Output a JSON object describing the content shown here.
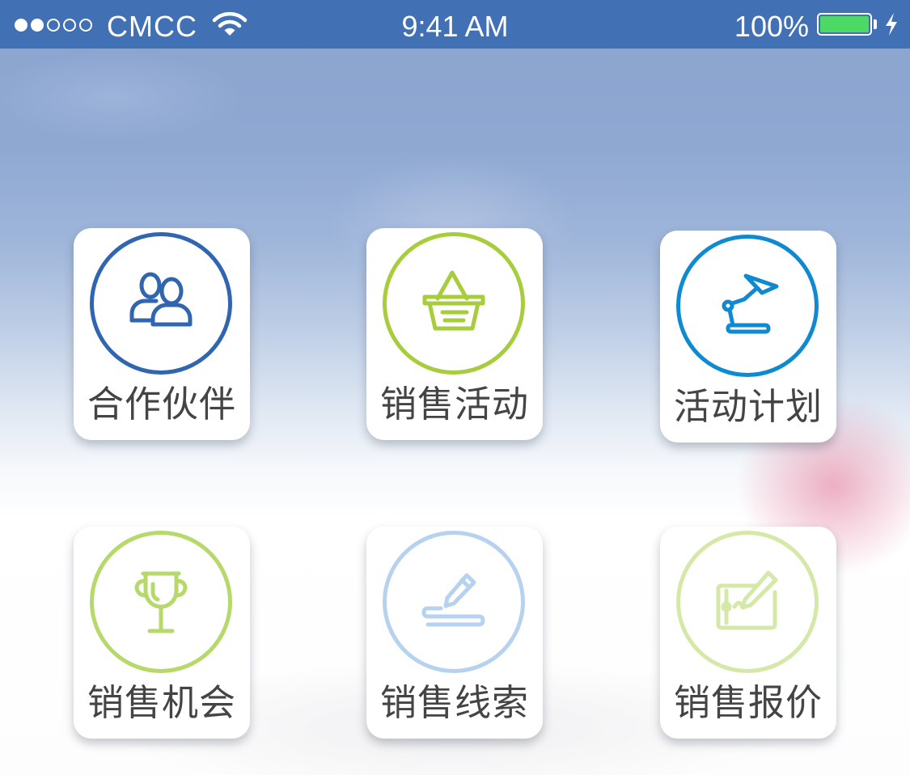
{
  "status_bar": {
    "carrier": "CMCC",
    "signal_bars_filled": 2,
    "signal_bars_total": 5,
    "time": "9:41 AM",
    "battery_percent": "100%",
    "charging": true
  },
  "colors": {
    "status_bar_bg": "#4170b5",
    "battery_fill": "#4cd964",
    "blue": "#3066b0",
    "green": "#a8cd3c",
    "cyan": "#0f8ad0",
    "light_green": "#b7d86a",
    "light_blue": "#b7d2ef",
    "pale_green": "#d6e8a8",
    "label_text": "#444444"
  },
  "menu": {
    "items": [
      {
        "label": "合作伙伴",
        "icon": "partners-icon",
        "color": "#3066b0"
      },
      {
        "label": "销售活动",
        "icon": "shopping-basket-icon",
        "color": "#a8cd3c"
      },
      {
        "label": "活动计划",
        "icon": "desk-lamp-icon",
        "color": "#0f8ad0"
      },
      {
        "label": "销售机会",
        "icon": "trophy-icon",
        "color": "#b7d86a"
      },
      {
        "label": "销售线索",
        "icon": "pencil-icon",
        "color": "#b7d2ef"
      },
      {
        "label": "销售报价",
        "icon": "signature-pad-icon",
        "color": "#d6e8a8"
      }
    ]
  }
}
